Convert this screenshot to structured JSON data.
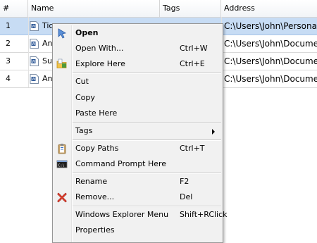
{
  "grid": {
    "columns": [
      "#",
      "Name",
      "Tags",
      "Address"
    ],
    "rows": [
      {
        "num": "1",
        "name": "Tic",
        "tags": "",
        "address": "C:\\Users\\John\\Persona",
        "selected": true
      },
      {
        "num": "2",
        "name": "An",
        "tags": "",
        "address": "C:\\Users\\John\\Docume",
        "selected": false
      },
      {
        "num": "3",
        "name": "Su",
        "tags": "",
        "address": "C:\\Users\\John\\Docume",
        "selected": false
      },
      {
        "num": "4",
        "name": "An",
        "tags": "",
        "address": "C:\\Users\\John\\Docume",
        "selected": false
      }
    ]
  },
  "menu": {
    "items": [
      {
        "label": "Open",
        "shortcut": "",
        "icon": "open-arrow-icon"
      },
      {
        "label": "Open With...",
        "shortcut": "Ctrl+W",
        "icon": ""
      },
      {
        "label": "Explore Here",
        "shortcut": "Ctrl+E",
        "icon": "folder-explore-icon"
      },
      {
        "label": "Cut",
        "shortcut": "",
        "icon": ""
      },
      {
        "label": "Copy",
        "shortcut": "",
        "icon": ""
      },
      {
        "label": "Paste Here",
        "shortcut": "",
        "icon": ""
      },
      {
        "label": "Tags",
        "shortcut": "",
        "icon": "",
        "submenu": true
      },
      {
        "label": "Copy Paths",
        "shortcut": "Ctrl+T",
        "icon": "clipboard-icon"
      },
      {
        "label": "Command Prompt Here",
        "shortcut": "",
        "icon": "command-prompt-icon"
      },
      {
        "label": "Rename",
        "shortcut": "F2",
        "icon": ""
      },
      {
        "label": "Remove...",
        "shortcut": "Del",
        "icon": "remove-x-icon"
      },
      {
        "label": "Windows Explorer Menu",
        "shortcut": "Shift+RClick",
        "icon": ""
      },
      {
        "label": "Properties",
        "shortcut": "",
        "icon": ""
      }
    ]
  }
}
